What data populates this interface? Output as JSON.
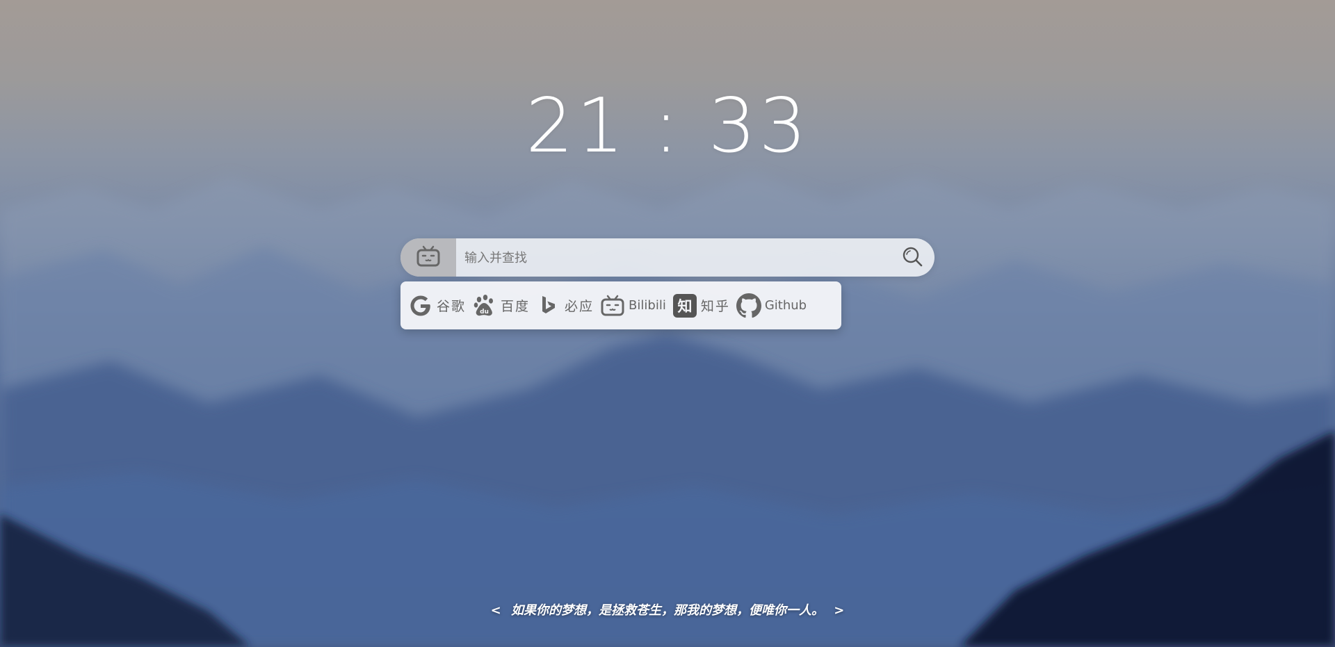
{
  "clock": {
    "time": "21 : 33"
  },
  "search": {
    "placeholder": "输入并查找",
    "current_engine_icon": "bilibili-tv-icon",
    "submit_icon": "search-icon"
  },
  "engines": [
    {
      "label": "谷歌",
      "icon": "google-icon"
    },
    {
      "label": "百度",
      "icon": "baidu-paw-icon"
    },
    {
      "label": "必应",
      "icon": "bing-icon"
    },
    {
      "label": "Bilibili",
      "icon": "bilibili-tv-icon"
    },
    {
      "label": "知乎",
      "icon": "zhihu-icon"
    },
    {
      "label": "Github",
      "icon": "github-icon"
    }
  ],
  "quote": {
    "prefix": "<",
    "text": "如果你的梦想，是拯救苍生，那我的梦想，便唯你一人。",
    "suffix": ">"
  },
  "colors": {
    "text_white": "#ffffff",
    "icon_gray": "#666666"
  }
}
